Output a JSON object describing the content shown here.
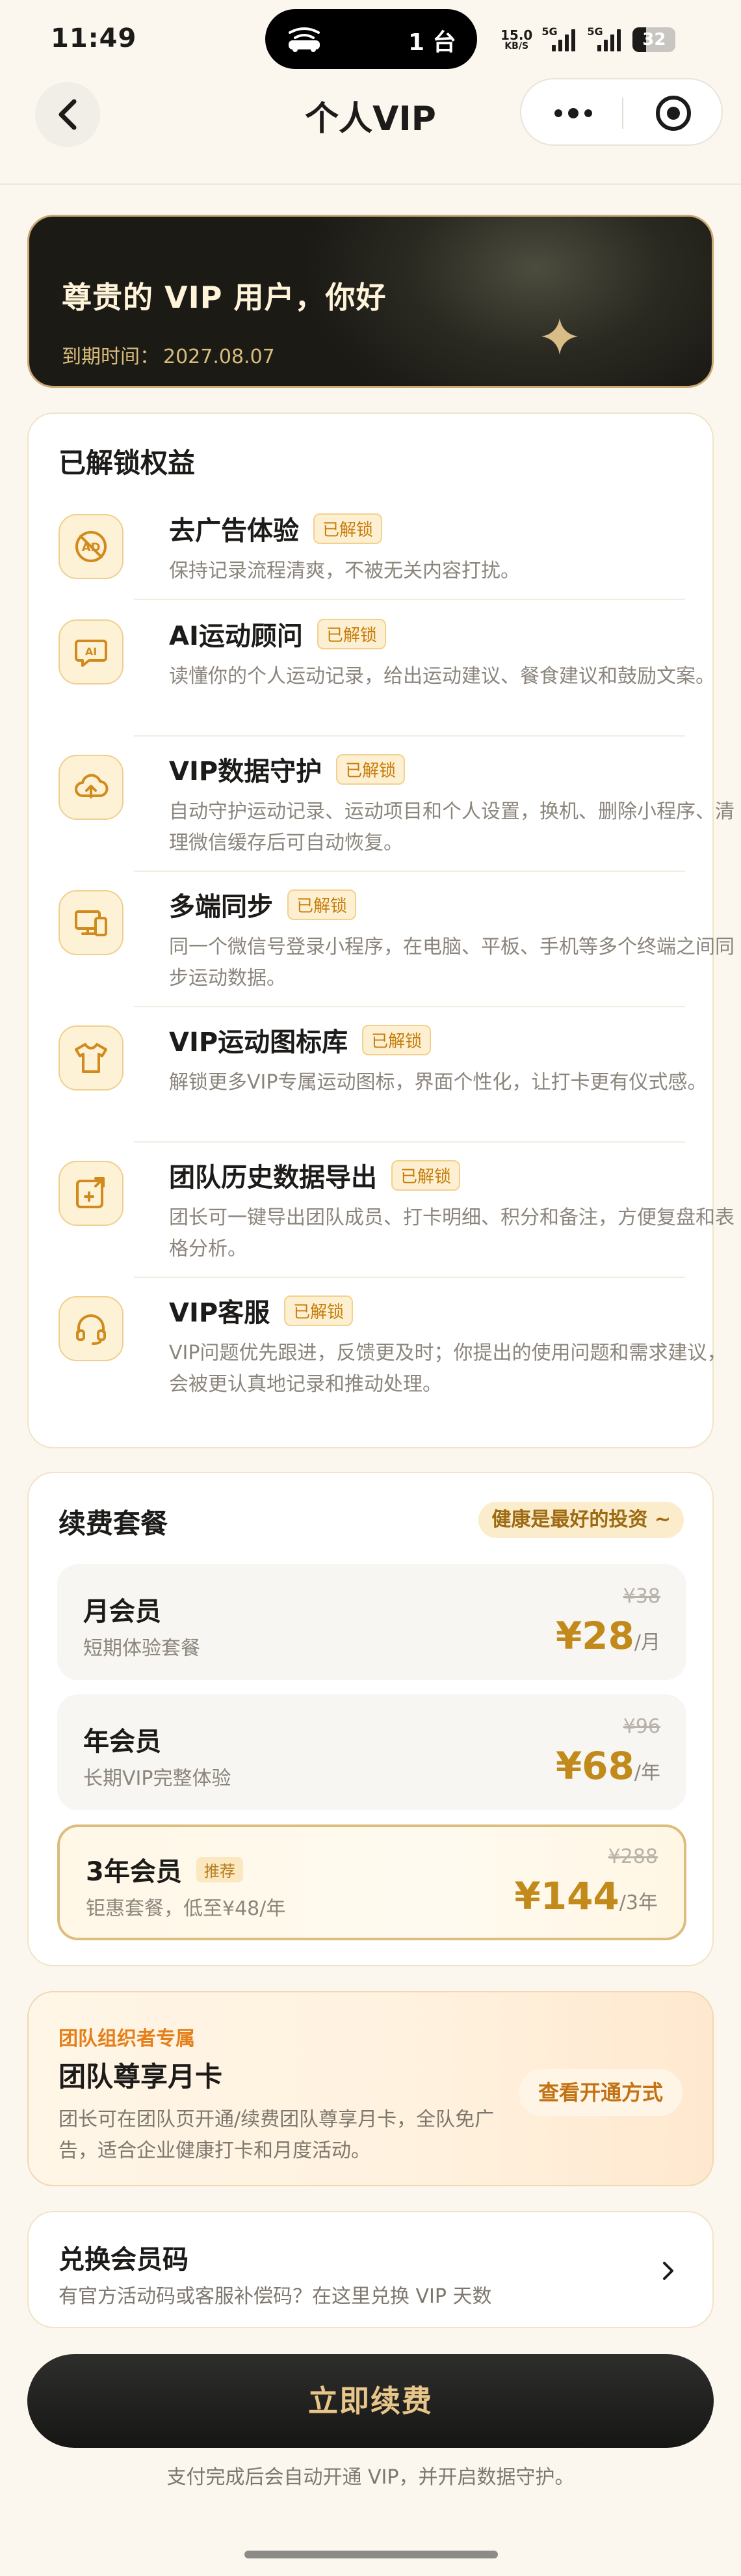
{
  "status_bar": {
    "time": "11:49",
    "island_text": "1 台",
    "net_speed": "15.0",
    "net_speed_unit": "KB/S",
    "signal_1_label": "5G",
    "signal_2_label": "5G",
    "battery_level": "32",
    "battery_fraction": 0.32
  },
  "nav": {
    "title": "个人VIP",
    "back_icon": "chevron-left-icon",
    "more_icon": "more-dots-icon",
    "close_icon": "target-close-icon"
  },
  "hero": {
    "greeting": "尊贵的 VIP 用户，你好",
    "expiry_label": "到期时间：",
    "expiry_date": "2027.08.07"
  },
  "benefits": {
    "title": "已解锁权益",
    "items": [
      {
        "icon": "no-ads-icon",
        "name": "去广告体验",
        "badge": "已解锁",
        "desc": "保持记录流程清爽，不被无关内容打扰。"
      },
      {
        "icon": "ai-chat-icon",
        "name": "AI运动顾问",
        "badge": "已解锁",
        "desc": "读懂你的个人运动记录，给出运动建议、餐食建议和鼓励文案。"
      },
      {
        "icon": "cloud-upload-icon",
        "name": "VIP数据守护",
        "badge": "已解锁",
        "desc": "自动守护运动记录、运动项目和个人设置，换机、删除小程序、清理微信缓存后可自动恢复。"
      },
      {
        "icon": "devices-icon",
        "name": "多端同步",
        "badge": "已解锁",
        "desc": "同一个微信号登录小程序，在电脑、平板、手机等多个终端之间同步运动数据。"
      },
      {
        "icon": "shirt-icon",
        "name": "VIP运动图标库",
        "badge": "已解锁",
        "desc": "解锁更多VIP专属运动图标，界面个性化，让打卡更有仪式感。"
      },
      {
        "icon": "export-icon",
        "name": "团队历史数据导出",
        "badge": "已解锁",
        "desc": "团长可一键导出团队成员、打卡明细、积分和备注，方便复盘和表格分析。"
      },
      {
        "icon": "headset-icon",
        "name": "VIP客服",
        "badge": "已解锁",
        "desc": "VIP问题优先跟进，反馈更及时；你提出的使用问题和需求建议，会被更认真地记录和推动处理。"
      }
    ]
  },
  "renewal": {
    "title": "续费套餐",
    "slogan": "健康是最好的投资 ~",
    "plans": [
      {
        "name": "月会员",
        "tag": "",
        "desc": "短期体验套餐",
        "original_price": "¥38",
        "price": "¥28",
        "unit": "/月",
        "recommended": false
      },
      {
        "name": "年会员",
        "tag": "",
        "desc": "长期VIP完整体验",
        "original_price": "¥96",
        "price": "¥68",
        "unit": "/年",
        "recommended": false
      },
      {
        "name": "3年会员",
        "tag": "推荐",
        "desc": "钜惠套餐，低至¥48/年",
        "original_price": "¥288",
        "price": "¥144",
        "unit": "/3年",
        "recommended": true
      }
    ]
  },
  "team": {
    "tag": "团队组织者专属",
    "title": "团队尊享月卡",
    "desc": "团长可在团队页开通/续费团队尊享月卡，全队免广告，适合企业健康打卡和月度活动。",
    "button": "查看开通方式"
  },
  "redeem": {
    "title": "兑换会员码",
    "desc": "有官方活动码或客服补偿码？在这里兑换 VIP 天数",
    "arrow_icon": "chevron-right-icon"
  },
  "cta": {
    "button": "立即续费",
    "note": "支付完成后会自动开通 VIP，并开启数据守护。"
  },
  "colors": {
    "page_bg": "#fbf6ee",
    "gold": "#c18a1b",
    "badge_orange": "#c77c0a",
    "hero_dark": "#1b1a15",
    "cta_text": "#e8c589"
  }
}
